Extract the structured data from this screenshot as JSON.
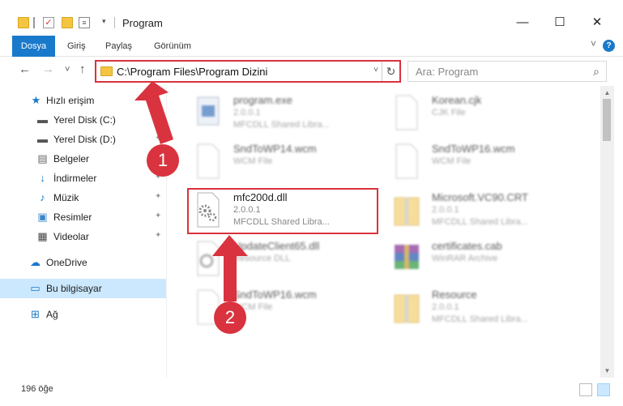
{
  "window": {
    "title": "Program",
    "minimize_glyph": "—",
    "maximize_glyph": "☐",
    "close_glyph": "✕"
  },
  "ribbon": {
    "tabs": [
      "Dosya",
      "Giriş",
      "Paylaş",
      "Görünüm"
    ],
    "help_glyph": "?",
    "collapse_glyph": "˅"
  },
  "nav": {
    "back_glyph": "←",
    "forward_glyph": "→",
    "recent_glyph": "˅",
    "up_glyph": "↑",
    "address_path": "C:\\Program Files\\Program Dizini",
    "address_dropdown_glyph": "˅",
    "refresh_glyph": "↻",
    "search_placeholder": "Ara: Program",
    "search_glyph": "⌕"
  },
  "sidebar": {
    "items": [
      {
        "label": "Hızlı erişim",
        "icon": "star-icon",
        "glyph": "★",
        "pinned": false
      },
      {
        "label": "Yerel Disk (C:)",
        "icon": "drive-icon",
        "glyph": "▬",
        "pinned": true
      },
      {
        "label": "Yerel Disk (D:)",
        "icon": "drive-icon",
        "glyph": "▬",
        "pinned": true
      },
      {
        "label": "Belgeler",
        "icon": "documents-icon",
        "glyph": "▤",
        "pinned": true
      },
      {
        "label": "İndirmeler",
        "icon": "download-icon",
        "glyph": "↓",
        "pinned": true
      },
      {
        "label": "Müzik",
        "icon": "music-icon",
        "glyph": "♪",
        "pinned": true
      },
      {
        "label": "Resimler",
        "icon": "pictures-icon",
        "glyph": "▣",
        "pinned": true
      },
      {
        "label": "Videolar",
        "icon": "video-icon",
        "glyph": "▦",
        "pinned": true
      },
      {
        "label": "OneDrive",
        "icon": "cloud-icon",
        "glyph": "☁",
        "pinned": false
      },
      {
        "label": "Bu bilgisayar",
        "icon": "computer-icon",
        "glyph": "▭",
        "pinned": false,
        "selected": true
      },
      {
        "label": "Ağ",
        "icon": "network-icon",
        "glyph": "⊞",
        "pinned": false
      }
    ],
    "pin_glyph": "✦"
  },
  "files": [
    {
      "name": "program.exe",
      "line2": "2.0.0.1",
      "line3": "MFCDLL Shared Libra...",
      "icon": "exe-icon",
      "blurred": true
    },
    {
      "name": "Korean.cjk",
      "line2": "CJK File",
      "line3": "",
      "icon": "file-icon",
      "blurred": true
    },
    {
      "name": "SndToWP14.wcm",
      "line2": "WCM File",
      "line3": "",
      "icon": "file-icon",
      "blurred": true
    },
    {
      "name": "SndToWP16.wcm",
      "line2": "WCM File",
      "line3": "",
      "icon": "file-icon",
      "blurred": true
    },
    {
      "name": "mfc200d.dll",
      "line2": "2.0.0.1",
      "line3": "MFCDLL Shared Libra...",
      "icon": "dll-gear-icon",
      "blurred": false
    },
    {
      "name": "Microsoft.VC90.CRT",
      "line2": "2.0.0.1",
      "line3": "MFCDLL Shared Libra...",
      "icon": "folder-zip-icon",
      "blurred": true
    },
    {
      "name": "UpdateClient65.dll",
      "line2": "Resource DLL",
      "line3": "",
      "icon": "dll-gear-icon",
      "blurred": true
    },
    {
      "name": "certificates.cab",
      "line2": "WinRAR Archive",
      "line3": "",
      "icon": "winrar-icon",
      "blurred": true
    },
    {
      "name": "SndToWP16.wcm",
      "line2": "WCM File",
      "line3": "",
      "icon": "file-icon",
      "blurred": true
    },
    {
      "name": "Resource",
      "line2": "2.0.0.1",
      "line3": "MFCDLL Shared Libra...",
      "icon": "folder-zip-icon",
      "blurred": true
    }
  ],
  "status": {
    "item_count": "196 öğe"
  },
  "callouts": [
    "1",
    "2"
  ],
  "colors": {
    "accent": "#1979ca",
    "annotation_red": "#d9333f",
    "selection": "#cce8ff"
  }
}
